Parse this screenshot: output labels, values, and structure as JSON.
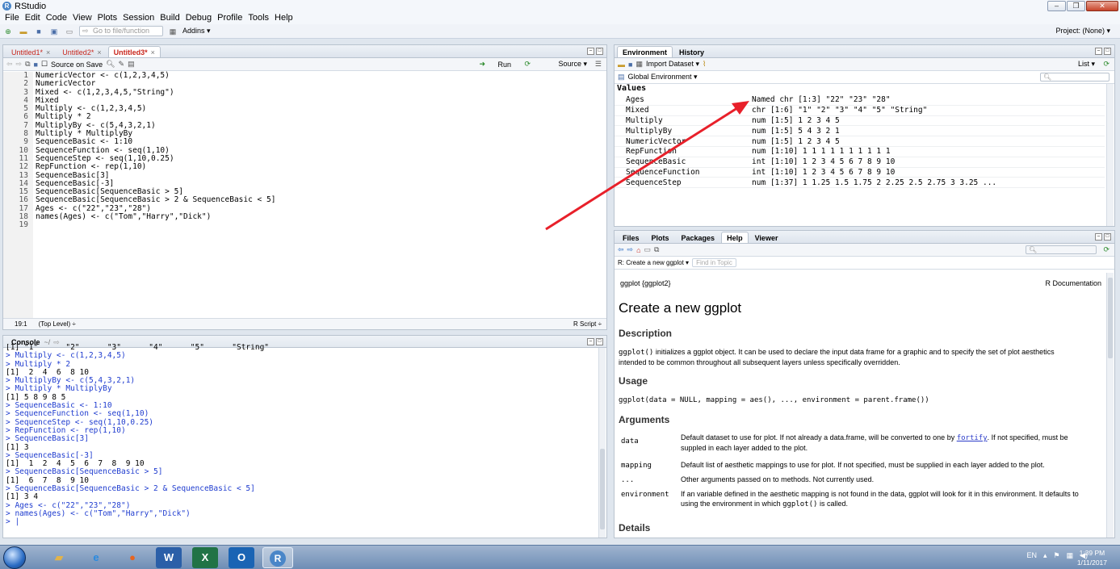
{
  "window": {
    "title": "RStudio",
    "buttons": [
      "–",
      "❐",
      "✕"
    ]
  },
  "menu": [
    "File",
    "Edit",
    "Code",
    "View",
    "Plots",
    "Session",
    "Build",
    "Debug",
    "Profile",
    "Tools",
    "Help"
  ],
  "toolbar": {
    "goto_placeholder": "Go to file/function",
    "addins": "Addins ▾",
    "project": "Project: (None) ▾"
  },
  "source": {
    "tabs": [
      "Untitled1*",
      "Untitled2*",
      "Untitled3*"
    ],
    "source_on_save": "Source on Save",
    "run": "Run",
    "source_btn": "Source ▾",
    "lines": [
      "NumericVector <- c(1,2,3,4,5)",
      "NumericVector",
      "Mixed <- c(1,2,3,4,5,\"String\")",
      "Mixed",
      "Multiply <- c(1,2,3,4,5)",
      "Multiply * 2",
      "MultiplyBy <- c(5,4,3,2,1)",
      "Multiply * MultiplyBy",
      "SequenceBasic <- 1:10",
      "SequenceFunction <- seq(1,10)",
      "SequenceStep <- seq(1,10,0.25)",
      "RepFunction <- rep(1,10)",
      "SequenceBasic[3]",
      "SequenceBasic[-3]",
      "SequenceBasic[SequenceBasic > 5]",
      "SequenceBasic[SequenceBasic > 2 & SequenceBasic < 5]",
      "Ages <- c(\"22\",\"23\",\"28\")",
      "names(Ages) <- c(\"Tom\",\"Harry\",\"Dick\")",
      ""
    ],
    "line_numbers": [
      "1",
      "2",
      "3",
      "4",
      "5",
      "6",
      "7",
      "8",
      "9",
      "10",
      "11",
      "12",
      "13",
      "14",
      "15",
      "16",
      "17",
      "18",
      "19"
    ],
    "status_pos": "19:1",
    "status_scope": "(Top Level) ÷",
    "status_type": "R Script ÷"
  },
  "console": {
    "tab": "Console",
    "path": "~/",
    "lines": [
      {
        "t": "out",
        "s": "[1] \"1\"      \"2\"      \"3\"      \"4\"      \"5\"      \"String\""
      },
      {
        "t": "cmd",
        "s": "> Multiply <- c(1,2,3,4,5)"
      },
      {
        "t": "cmd",
        "s": "> Multiply * 2"
      },
      {
        "t": "out",
        "s": "[1]  2  4  6  8 10"
      },
      {
        "t": "cmd",
        "s": "> MultiplyBy <- c(5,4,3,2,1)"
      },
      {
        "t": "cmd",
        "s": "> Multiply * MultiplyBy"
      },
      {
        "t": "out",
        "s": "[1] 5 8 9 8 5"
      },
      {
        "t": "cmd",
        "s": "> SequenceBasic <- 1:10"
      },
      {
        "t": "cmd",
        "s": "> SequenceFunction <- seq(1,10)"
      },
      {
        "t": "cmd",
        "s": "> SequenceStep <- seq(1,10,0.25)"
      },
      {
        "t": "cmd",
        "s": "> RepFunction <- rep(1,10)"
      },
      {
        "t": "cmd",
        "s": "> SequenceBasic[3]"
      },
      {
        "t": "out",
        "s": "[1] 3"
      },
      {
        "t": "cmd",
        "s": "> SequenceBasic[-3]"
      },
      {
        "t": "out",
        "s": "[1]  1  2  4  5  6  7  8  9 10"
      },
      {
        "t": "cmd",
        "s": "> SequenceBasic[SequenceBasic > 5]"
      },
      {
        "t": "out",
        "s": "[1]  6  7  8  9 10"
      },
      {
        "t": "cmd",
        "s": "> SequenceBasic[SequenceBasic > 2 & SequenceBasic < 5]"
      },
      {
        "t": "out",
        "s": "[1] 3 4"
      },
      {
        "t": "cmd",
        "s": "> Ages <- c(\"22\",\"23\",\"28\")"
      },
      {
        "t": "cmd",
        "s": "> names(Ages) <- c(\"Tom\",\"Harry\",\"Dick\")"
      },
      {
        "t": "cmd",
        "s": "> |"
      }
    ]
  },
  "environment": {
    "tabs": [
      "Environment",
      "History"
    ],
    "import": "Import Dataset ▾",
    "list": "List ▾",
    "scope": "Global Environment ▾",
    "section": "Values",
    "rows": [
      {
        "name": "Ages",
        "value": "Named chr [1:3] \"22\" \"23\" \"28\""
      },
      {
        "name": "Mixed",
        "value": "chr [1:6] \"1\" \"2\" \"3\" \"4\" \"5\" \"String\""
      },
      {
        "name": "Multiply",
        "value": "num [1:5] 1 2 3 4 5"
      },
      {
        "name": "MultiplyBy",
        "value": "num [1:5] 5 4 3 2 1"
      },
      {
        "name": "NumericVector",
        "value": "num [1:5] 1 2 3 4 5"
      },
      {
        "name": "RepFunction",
        "value": "num [1:10] 1 1 1 1 1 1 1 1 1 1"
      },
      {
        "name": "SequenceBasic",
        "value": "int [1:10] 1 2 3 4 5 6 7 8 9 10"
      },
      {
        "name": "SequenceFunction",
        "value": "int [1:10] 1 2 3 4 5 6 7 8 9 10"
      },
      {
        "name": "SequenceStep",
        "value": "num [1:37] 1 1.25 1.5 1.75 2 2.25 2.5 2.75 3 3.25 ..."
      }
    ]
  },
  "help": {
    "tabs": [
      "Files",
      "Plots",
      "Packages",
      "Help",
      "Viewer"
    ],
    "topic": "R: Create a new ggplot ▾",
    "find_placeholder": "Find in Topic",
    "pkg": "ggplot {ggplot2}",
    "rdoc": "R Documentation",
    "title": "Create a new ggplot",
    "description_h": "Description",
    "description_code": "ggplot()",
    "description": " initializes a ggplot object. It can be used to declare the input data frame for a graphic and to specify the set of plot aesthetics",
    "description2": "intended to be common throughout all subsequent layers unless specifically overridden.",
    "usage_h": "Usage",
    "usage": "ggplot(data = NULL, mapping = aes(), ..., environment = parent.frame())",
    "arguments_h": "Arguments",
    "args": [
      {
        "name": "data",
        "desc": "Default dataset to use for plot. If not already a data.frame, will be converted to one by ",
        "link": "fortify",
        "desc2": ". If not specified, must be",
        "desc3": "suppled in each layer added to the plot."
      },
      {
        "name": "mapping",
        "desc": "Default list of aesthetic mappings to use for plot. If not specified, must be supplied in each layer added to the plot."
      },
      {
        "name": "...",
        "desc": "Other arguments passed on to methods. Not currently used."
      },
      {
        "name": "environment",
        "desc": "If an variable defined in the aesthetic mapping is not found in the data, ggplot will look for it in this environment. It defaults to",
        "desc3a": "using the environment in which ",
        "code3": "ggplot()",
        "desc3b": " is called."
      }
    ],
    "details_h": "Details"
  },
  "taskbar": {
    "apps": [
      "Explorer",
      "IE",
      "Firefox",
      "Word",
      "Excel",
      "Outlook",
      "RStudio"
    ],
    "lang": "EN",
    "time": "1:39 PM",
    "date": "1/11/2017"
  },
  "colors": {
    "arrow": "#e8202a",
    "command": "#1f3ccf",
    "tab_modified": "#c8271e"
  }
}
